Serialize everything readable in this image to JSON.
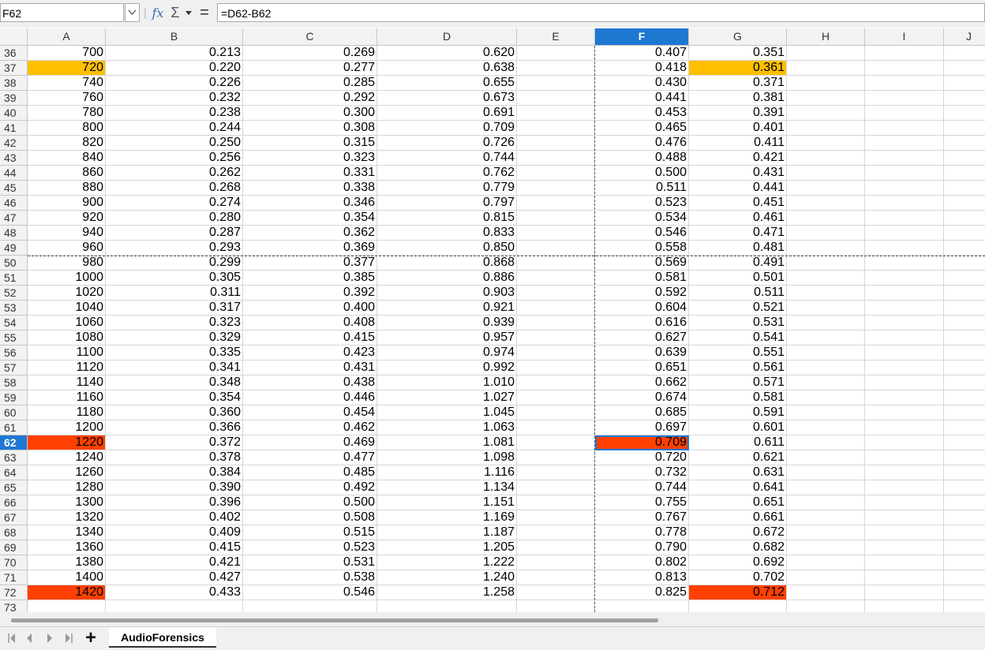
{
  "formula_bar": {
    "cell_ref": "F62",
    "formula": "=D62-B62",
    "fx_symbol": "fx",
    "sum_symbol": "Σ",
    "equals_symbol": "="
  },
  "columns": [
    "A",
    "B",
    "C",
    "D",
    "E",
    "F",
    "G",
    "H",
    "I",
    "J"
  ],
  "selected_column": "F",
  "selected_row": 62,
  "rows": [
    {
      "n": "36",
      "A": "700",
      "B": "0.213",
      "C": "0.269",
      "D": "0.620",
      "F": "0.407",
      "G": "0.351"
    },
    {
      "n": "37",
      "A": "720",
      "B": "0.220",
      "C": "0.277",
      "D": "0.638",
      "F": "0.418",
      "G": "0.361"
    },
    {
      "n": "38",
      "A": "740",
      "B": "0.226",
      "C": "0.285",
      "D": "0.655",
      "F": "0.430",
      "G": "0.371"
    },
    {
      "n": "39",
      "A": "760",
      "B": "0.232",
      "C": "0.292",
      "D": "0.673",
      "F": "0.441",
      "G": "0.381"
    },
    {
      "n": "40",
      "A": "780",
      "B": "0.238",
      "C": "0.300",
      "D": "0.691",
      "F": "0.453",
      "G": "0.391"
    },
    {
      "n": "41",
      "A": "800",
      "B": "0.244",
      "C": "0.308",
      "D": "0.709",
      "F": "0.465",
      "G": "0.401"
    },
    {
      "n": "42",
      "A": "820",
      "B": "0.250",
      "C": "0.315",
      "D": "0.726",
      "F": "0.476",
      "G": "0.411"
    },
    {
      "n": "43",
      "A": "840",
      "B": "0.256",
      "C": "0.323",
      "D": "0.744",
      "F": "0.488",
      "G": "0.421"
    },
    {
      "n": "44",
      "A": "860",
      "B": "0.262",
      "C": "0.331",
      "D": "0.762",
      "F": "0.500",
      "G": "0.431"
    },
    {
      "n": "45",
      "A": "880",
      "B": "0.268",
      "C": "0.338",
      "D": "0.779",
      "F": "0.511",
      "G": "0.441"
    },
    {
      "n": "46",
      "A": "900",
      "B": "0.274",
      "C": "0.346",
      "D": "0.797",
      "F": "0.523",
      "G": "0.451"
    },
    {
      "n": "47",
      "A": "920",
      "B": "0.280",
      "C": "0.354",
      "D": "0.815",
      "F": "0.534",
      "G": "0.461"
    },
    {
      "n": "48",
      "A": "940",
      "B": "0.287",
      "C": "0.362",
      "D": "0.833",
      "F": "0.546",
      "G": "0.471"
    },
    {
      "n": "49",
      "A": "960",
      "B": "0.293",
      "C": "0.369",
      "D": "0.850",
      "F": "0.558",
      "G": "0.481"
    },
    {
      "n": "50",
      "A": "980",
      "B": "0.299",
      "C": "0.377",
      "D": "0.868",
      "F": "0.569",
      "G": "0.491"
    },
    {
      "n": "51",
      "A": "1000",
      "B": "0.305",
      "C": "0.385",
      "D": "0.886",
      "F": "0.581",
      "G": "0.501"
    },
    {
      "n": "52",
      "A": "1020",
      "B": "0.311",
      "C": "0.392",
      "D": "0.903",
      "F": "0.592",
      "G": "0.511"
    },
    {
      "n": "53",
      "A": "1040",
      "B": "0.317",
      "C": "0.400",
      "D": "0.921",
      "F": "0.604",
      "G": "0.521"
    },
    {
      "n": "54",
      "A": "1060",
      "B": "0.323",
      "C": "0.408",
      "D": "0.939",
      "F": "0.616",
      "G": "0.531"
    },
    {
      "n": "55",
      "A": "1080",
      "B": "0.329",
      "C": "0.415",
      "D": "0.957",
      "F": "0.627",
      "G": "0.541"
    },
    {
      "n": "56",
      "A": "1100",
      "B": "0.335",
      "C": "0.423",
      "D": "0.974",
      "F": "0.639",
      "G": "0.551"
    },
    {
      "n": "57",
      "A": "1120",
      "B": "0.341",
      "C": "0.431",
      "D": "0.992",
      "F": "0.651",
      "G": "0.561"
    },
    {
      "n": "58",
      "A": "1140",
      "B": "0.348",
      "C": "0.438",
      "D": "1.010",
      "F": "0.662",
      "G": "0.571"
    },
    {
      "n": "59",
      "A": "1160",
      "B": "0.354",
      "C": "0.446",
      "D": "1.027",
      "F": "0.674",
      "G": "0.581"
    },
    {
      "n": "60",
      "A": "1180",
      "B": "0.360",
      "C": "0.454",
      "D": "1.045",
      "F": "0.685",
      "G": "0.591"
    },
    {
      "n": "61",
      "A": "1200",
      "B": "0.366",
      "C": "0.462",
      "D": "1.063",
      "F": "0.697",
      "G": "0.601"
    },
    {
      "n": "62",
      "A": "1220",
      "B": "0.372",
      "C": "0.469",
      "D": "1.081",
      "F": "0.709",
      "G": "0.611"
    },
    {
      "n": "63",
      "A": "1240",
      "B": "0.378",
      "C": "0.477",
      "D": "1.098",
      "F": "0.720",
      "G": "0.621"
    },
    {
      "n": "64",
      "A": "1260",
      "B": "0.384",
      "C": "0.485",
      "D": "1.116",
      "F": "0.732",
      "G": "0.631"
    },
    {
      "n": "65",
      "A": "1280",
      "B": "0.390",
      "C": "0.492",
      "D": "1.134",
      "F": "0.744",
      "G": "0.641"
    },
    {
      "n": "66",
      "A": "1300",
      "B": "0.396",
      "C": "0.500",
      "D": "1.151",
      "F": "0.755",
      "G": "0.651"
    },
    {
      "n": "67",
      "A": "1320",
      "B": "0.402",
      "C": "0.508",
      "D": "1.169",
      "F": "0.767",
      "G": "0.661"
    },
    {
      "n": "68",
      "A": "1340",
      "B": "0.409",
      "C": "0.515",
      "D": "1.187",
      "F": "0.778",
      "G": "0.672"
    },
    {
      "n": "69",
      "A": "1360",
      "B": "0.415",
      "C": "0.523",
      "D": "1.205",
      "F": "0.790",
      "G": "0.682"
    },
    {
      "n": "70",
      "A": "1380",
      "B": "0.421",
      "C": "0.531",
      "D": "1.222",
      "F": "0.802",
      "G": "0.692"
    },
    {
      "n": "71",
      "A": "1400",
      "B": "0.427",
      "C": "0.538",
      "D": "1.240",
      "F": "0.813",
      "G": "0.702"
    },
    {
      "n": "72",
      "A": "1420",
      "B": "0.433",
      "C": "0.546",
      "D": "1.258",
      "F": "0.825",
      "G": "0.712"
    },
    {
      "n": "73"
    }
  ],
  "highlights": [
    {
      "row": "37",
      "col": "A",
      "color": "#ffbf00"
    },
    {
      "row": "37",
      "col": "G",
      "color": "#ffbf00"
    },
    {
      "row": "62",
      "col": "A",
      "color": "#ff4000"
    },
    {
      "row": "62",
      "col": "F",
      "color": "#ff4000"
    },
    {
      "row": "72",
      "col": "A",
      "color": "#ff4000"
    },
    {
      "row": "72",
      "col": "G",
      "color": "#ff4000"
    }
  ],
  "sheet_tabs": [
    {
      "label": "AudioForensics",
      "active": true
    }
  ],
  "add_sheet_label": "+",
  "icons": {
    "name_box_dropdown": "chevron-down-icon",
    "function_wizard": "fx-icon",
    "sum": "sigma-icon",
    "sum_dropdown": "caret-down-icon",
    "equals": "equals-icon",
    "nav_first": "first-sheet-icon",
    "nav_prev": "prev-sheet-icon",
    "nav_next": "next-sheet-icon",
    "nav_last": "last-sheet-icon"
  }
}
